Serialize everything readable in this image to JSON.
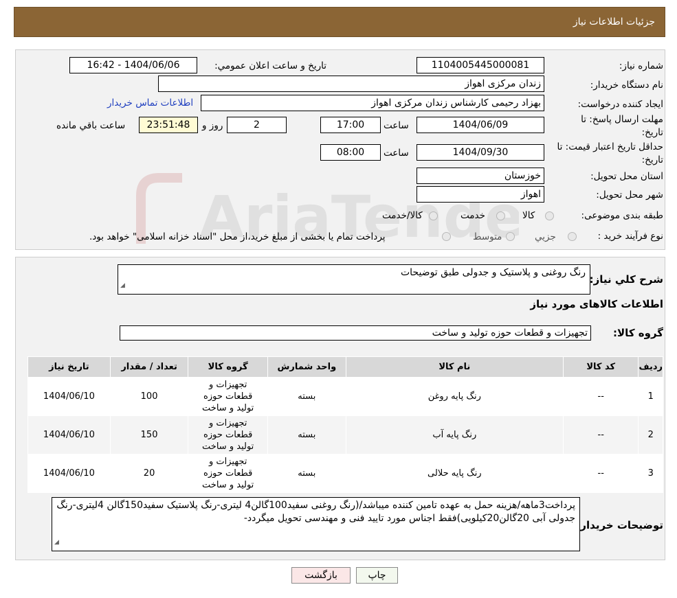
{
  "header": {
    "title": "جزئیات اطلاعات نیاز"
  },
  "form": {
    "need_number_label": "شماره نیاز:",
    "need_number": "1104005445000081",
    "announce_label": "تاریخ و ساعت اعلان عمومي:",
    "announce_value": "1404/06/06 - 16:42",
    "buyer_org_label": "نام دستگاه خریدار:",
    "buyer_org": "زندان مرکزی اهواز",
    "creator_label": "ایجاد کننده درخواست:",
    "creator": "بهزاد رحیمی کارشناس زندان مرکزی اهواز",
    "contact_link": "اطلاعات تماس خریدار",
    "deadline_label_1": "مهلت ارسال پاسخ: تا",
    "deadline_label_2": "تاریخ:",
    "deadline_date": "1404/06/09",
    "time_label": "ساعت",
    "deadline_time": "17:00",
    "days": "2",
    "days_label": "روز و",
    "remaining": "23:51:48",
    "remaining_label": "ساعت باقي مانده",
    "validity_label_1": "حداقل تاریخ اعتبار قیمت: تا",
    "validity_label_2": "تاریخ:",
    "validity_date": "1404/09/30",
    "validity_time": "08:00",
    "province_label": "استان محل تحویل:",
    "province": "خوزستان",
    "city_label": "شهر محل تحویل:",
    "city": "اهواز",
    "category_label": "طبقه بندی موضوعی:",
    "category_options": [
      "کالا",
      "خدمت",
      "کالا/خدمت"
    ],
    "process_label": "نوع فرآیند خرید :",
    "process_options": [
      "جزيي",
      "متوسط"
    ],
    "process_note": "پرداخت تمام یا بخشی از مبلغ خرید،از محل \"اسناد خزانه اسلامی\" خواهد بود."
  },
  "summary": {
    "label": "شرح کلي نياز:",
    "text": "رنگ روغنی  و پلاستیک و جدولی طبق توضیحات",
    "items_title": "اطلاعات کالاهای مورد نیاز",
    "group_label": "گروه کالا:",
    "group_value": "تجهیزات و قطعات حوزه تولید و ساخت"
  },
  "table": {
    "headers": [
      "ردیف",
      "کد کالا",
      "نام کالا",
      "واحد شمارش",
      "گروه کالا",
      "تعداد / مقدار",
      "تاریخ نیاز"
    ],
    "rows": [
      {
        "idx": "1",
        "code": "--",
        "name": "رنگ پایه روغن",
        "unit": "بسته",
        "group": "تجهیزات و قطعات حوزه تولید و ساخت",
        "qty": "100",
        "date": "1404/06/10"
      },
      {
        "idx": "2",
        "code": "--",
        "name": "رنگ پایه آب",
        "unit": "بسته",
        "group": "تجهیزات و قطعات حوزه تولید و ساخت",
        "qty": "150",
        "date": "1404/06/10"
      },
      {
        "idx": "3",
        "code": "--",
        "name": "رنگ پایه حلالی",
        "unit": "بسته",
        "group": "تجهیزات و قطعات حوزه تولید و ساخت",
        "qty": "20",
        "date": "1404/06/10"
      }
    ]
  },
  "notes": {
    "label": "توضیحات خریدار:",
    "text": "پرداخت3ماهه/هزینه حمل به عهده تامین کننده میباشد/(رنگ روغنی سفید100گالن4 لیتری-رنگ پلاستیک سفید150گالن 4لیتری-رنگ جدولی آبی 20گالن20کیلویی)فقط اجناس مورد تایید فنی و مهندسی تحویل میگردد-"
  },
  "buttons": {
    "print": "چاپ",
    "back": "بازگشت"
  },
  "watermark": {
    "text": "AriaTender.neT"
  }
}
